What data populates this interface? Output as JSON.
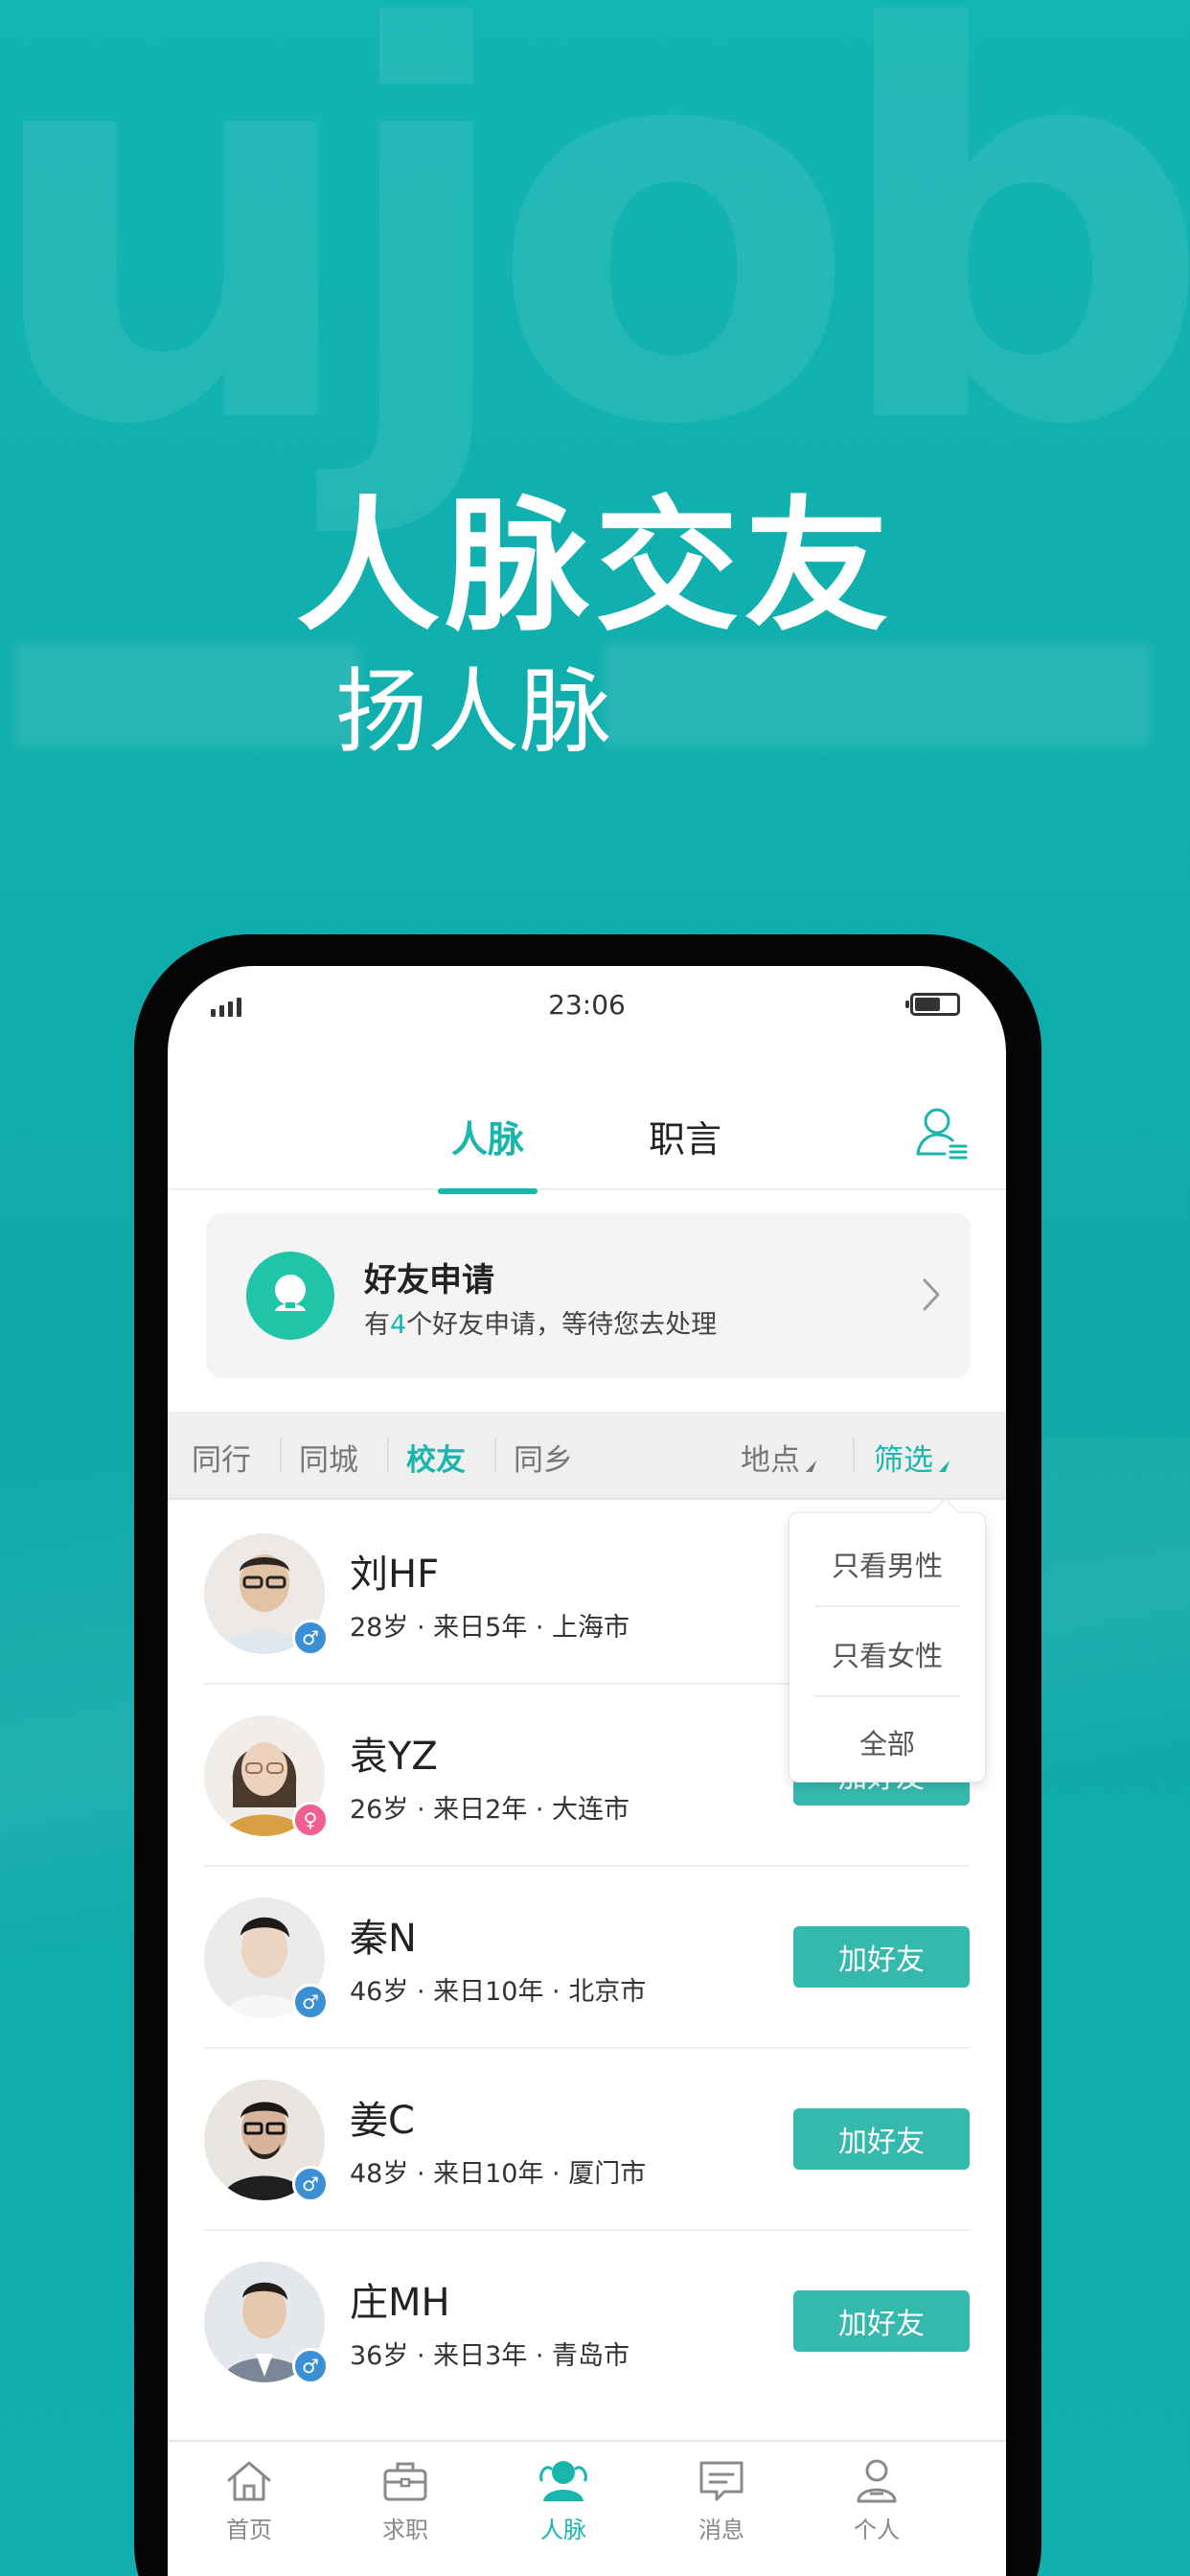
{
  "background": {
    "watermark": "ujob",
    "accent": "#18b6ad"
  },
  "hero": {
    "title": "人脉交友",
    "subtitle": "扬人脉"
  },
  "status_bar": {
    "time": "23:06"
  },
  "top_tabs": {
    "tabs": [
      "人脉",
      "职言"
    ],
    "active": "人脉",
    "contacts_icon": "contacts-icon"
  },
  "friend_request": {
    "title": "好友申请",
    "desc_prefix": "有",
    "count": "4",
    "desc_suffix": "个好友申请，等待您去处理",
    "icon": "avatar-icon",
    "chevron": "chevron-right-icon"
  },
  "filters": {
    "tabs": [
      "同行",
      "同城",
      "校友",
      "同乡"
    ],
    "active": "校友",
    "location_label": "地点",
    "filter_label": "筛选"
  },
  "dropdown": {
    "options": [
      "只看男性",
      "只看女性",
      "全部"
    ]
  },
  "people": [
    {
      "name": "刘HF",
      "info": "28岁 · 来日5年 · 上海市",
      "gender": "male",
      "action": ""
    },
    {
      "name": "袁YZ",
      "info": "26岁 · 来日2年 · 大连市",
      "gender": "female",
      "action": "加好友"
    },
    {
      "name": "秦N",
      "info": "46岁 · 来日10年 · 北京市",
      "gender": "male",
      "action": "加好友"
    },
    {
      "name": "姜C",
      "info": "48岁 · 来日10年 · 厦门市",
      "gender": "male",
      "action": "加好友"
    },
    {
      "name": "庄MH",
      "info": "36岁 · 来日3年 · 青岛市",
      "gender": "male",
      "action": "加好友"
    }
  ],
  "gender_symbols": {
    "male": "♂",
    "female": "♀"
  },
  "bottom_nav": [
    {
      "label": "首页",
      "icon": "home-icon"
    },
    {
      "label": "求职",
      "icon": "briefcase-icon"
    },
    {
      "label": "人脉",
      "icon": "people-icon",
      "active": true
    },
    {
      "label": "消息",
      "icon": "message-icon"
    },
    {
      "label": "个人",
      "icon": "profile-icon"
    }
  ]
}
